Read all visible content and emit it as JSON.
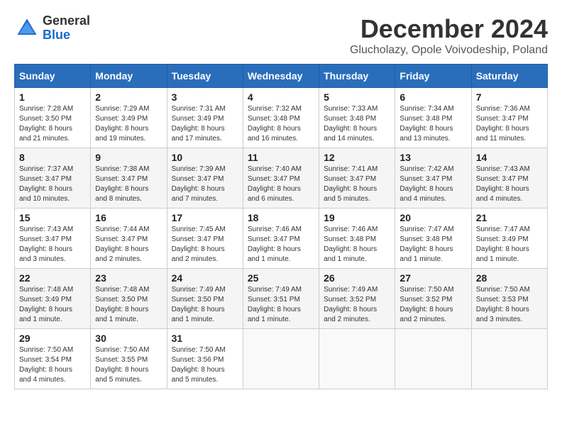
{
  "header": {
    "logo_general": "General",
    "logo_blue": "Blue",
    "month_title": "December 2024",
    "location": "Glucholazy, Opole Voivodeship, Poland"
  },
  "days_of_week": [
    "Sunday",
    "Monday",
    "Tuesday",
    "Wednesday",
    "Thursday",
    "Friday",
    "Saturday"
  ],
  "weeks": [
    [
      {
        "day": "1",
        "sunrise": "7:28 AM",
        "sunset": "3:50 PM",
        "daylight": "8 hours and 21 minutes."
      },
      {
        "day": "2",
        "sunrise": "7:29 AM",
        "sunset": "3:49 PM",
        "daylight": "8 hours and 19 minutes."
      },
      {
        "day": "3",
        "sunrise": "7:31 AM",
        "sunset": "3:49 PM",
        "daylight": "8 hours and 17 minutes."
      },
      {
        "day": "4",
        "sunrise": "7:32 AM",
        "sunset": "3:48 PM",
        "daylight": "8 hours and 16 minutes."
      },
      {
        "day": "5",
        "sunrise": "7:33 AM",
        "sunset": "3:48 PM",
        "daylight": "8 hours and 14 minutes."
      },
      {
        "day": "6",
        "sunrise": "7:34 AM",
        "sunset": "3:48 PM",
        "daylight": "8 hours and 13 minutes."
      },
      {
        "day": "7",
        "sunrise": "7:36 AM",
        "sunset": "3:47 PM",
        "daylight": "8 hours and 11 minutes."
      }
    ],
    [
      {
        "day": "8",
        "sunrise": "7:37 AM",
        "sunset": "3:47 PM",
        "daylight": "8 hours and 10 minutes."
      },
      {
        "day": "9",
        "sunrise": "7:38 AM",
        "sunset": "3:47 PM",
        "daylight": "8 hours and 8 minutes."
      },
      {
        "day": "10",
        "sunrise": "7:39 AM",
        "sunset": "3:47 PM",
        "daylight": "8 hours and 7 minutes."
      },
      {
        "day": "11",
        "sunrise": "7:40 AM",
        "sunset": "3:47 PM",
        "daylight": "8 hours and 6 minutes."
      },
      {
        "day": "12",
        "sunrise": "7:41 AM",
        "sunset": "3:47 PM",
        "daylight": "8 hours and 5 minutes."
      },
      {
        "day": "13",
        "sunrise": "7:42 AM",
        "sunset": "3:47 PM",
        "daylight": "8 hours and 4 minutes."
      },
      {
        "day": "14",
        "sunrise": "7:43 AM",
        "sunset": "3:47 PM",
        "daylight": "8 hours and 4 minutes."
      }
    ],
    [
      {
        "day": "15",
        "sunrise": "7:43 AM",
        "sunset": "3:47 PM",
        "daylight": "8 hours and 3 minutes."
      },
      {
        "day": "16",
        "sunrise": "7:44 AM",
        "sunset": "3:47 PM",
        "daylight": "8 hours and 2 minutes."
      },
      {
        "day": "17",
        "sunrise": "7:45 AM",
        "sunset": "3:47 PM",
        "daylight": "8 hours and 2 minutes."
      },
      {
        "day": "18",
        "sunrise": "7:46 AM",
        "sunset": "3:47 PM",
        "daylight": "8 hours and 1 minute."
      },
      {
        "day": "19",
        "sunrise": "7:46 AM",
        "sunset": "3:48 PM",
        "daylight": "8 hours and 1 minute."
      },
      {
        "day": "20",
        "sunrise": "7:47 AM",
        "sunset": "3:48 PM",
        "daylight": "8 hours and 1 minute."
      },
      {
        "day": "21",
        "sunrise": "7:47 AM",
        "sunset": "3:49 PM",
        "daylight": "8 hours and 1 minute."
      }
    ],
    [
      {
        "day": "22",
        "sunrise": "7:48 AM",
        "sunset": "3:49 PM",
        "daylight": "8 hours and 1 minute."
      },
      {
        "day": "23",
        "sunrise": "7:48 AM",
        "sunset": "3:50 PM",
        "daylight": "8 hours and 1 minute."
      },
      {
        "day": "24",
        "sunrise": "7:49 AM",
        "sunset": "3:50 PM",
        "daylight": "8 hours and 1 minute."
      },
      {
        "day": "25",
        "sunrise": "7:49 AM",
        "sunset": "3:51 PM",
        "daylight": "8 hours and 1 minute."
      },
      {
        "day": "26",
        "sunrise": "7:49 AM",
        "sunset": "3:52 PM",
        "daylight": "8 hours and 2 minutes."
      },
      {
        "day": "27",
        "sunrise": "7:50 AM",
        "sunset": "3:52 PM",
        "daylight": "8 hours and 2 minutes."
      },
      {
        "day": "28",
        "sunrise": "7:50 AM",
        "sunset": "3:53 PM",
        "daylight": "8 hours and 3 minutes."
      }
    ],
    [
      {
        "day": "29",
        "sunrise": "7:50 AM",
        "sunset": "3:54 PM",
        "daylight": "8 hours and 4 minutes."
      },
      {
        "day": "30",
        "sunrise": "7:50 AM",
        "sunset": "3:55 PM",
        "daylight": "8 hours and 5 minutes."
      },
      {
        "day": "31",
        "sunrise": "7:50 AM",
        "sunset": "3:56 PM",
        "daylight": "8 hours and 5 minutes."
      },
      null,
      null,
      null,
      null
    ]
  ],
  "labels": {
    "sunrise": "Sunrise:",
    "sunset": "Sunset:",
    "daylight": "Daylight:"
  }
}
